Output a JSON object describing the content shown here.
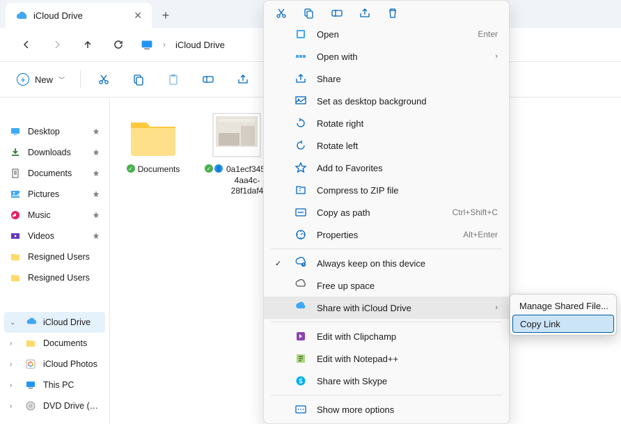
{
  "tab": {
    "title": "iCloud Drive"
  },
  "nav": {
    "breadcrumb": "iCloud Drive"
  },
  "toolbar": {
    "new_label": "New"
  },
  "sidebar": {
    "quick": [
      {
        "icon": "desktop",
        "label": "Desktop",
        "pinned": true
      },
      {
        "icon": "downloads",
        "label": "Downloads",
        "pinned": true
      },
      {
        "icon": "documents",
        "label": "Documents",
        "pinned": true
      },
      {
        "icon": "pictures",
        "label": "Pictures",
        "pinned": true
      },
      {
        "icon": "music",
        "label": "Music",
        "pinned": true
      },
      {
        "icon": "videos",
        "label": "Videos",
        "pinned": true
      },
      {
        "icon": "folder",
        "label": "Resigned Users",
        "pinned": false
      },
      {
        "icon": "folder",
        "label": "Resigned Users",
        "pinned": false
      }
    ],
    "tree": [
      {
        "icon": "icloud",
        "label": "iCloud Drive",
        "exp": "v",
        "selected": true
      },
      {
        "icon": "folder",
        "label": "Documents",
        "exp": ">",
        "selected": false
      },
      {
        "icon": "iclphotos",
        "label": "iCloud Photos",
        "exp": ">",
        "selected": false
      },
      {
        "icon": "thispc",
        "label": "This PC",
        "exp": ">",
        "selected": false
      },
      {
        "icon": "dvd",
        "label": "DVD Drive (F:)",
        "exp": ">",
        "selected": false
      }
    ]
  },
  "files": [
    {
      "kind": "folder",
      "name": "Documents",
      "badges": [
        "g"
      ]
    },
    {
      "kind": "photo",
      "name": "0a1ecf345-4aa4c-28f1daf4",
      "badges": [
        "g",
        "b"
      ]
    }
  ],
  "ctx": {
    "items": [
      {
        "icon": "open",
        "label": "Open",
        "hint": "Enter"
      },
      {
        "icon": "openwith",
        "label": "Open with",
        "arrow": true
      },
      {
        "icon": "share",
        "label": "Share"
      },
      {
        "icon": "bg",
        "label": "Set as desktop background"
      },
      {
        "icon": "rotr",
        "label": "Rotate right"
      },
      {
        "icon": "rotl",
        "label": "Rotate left"
      },
      {
        "icon": "fav",
        "label": "Add to Favorites"
      },
      {
        "icon": "zip",
        "label": "Compress to ZIP file"
      },
      {
        "icon": "path",
        "label": "Copy as path",
        "hint": "Ctrl+Shift+C"
      },
      {
        "icon": "prop",
        "label": "Properties",
        "hint": "Alt+Enter"
      }
    ],
    "cloud": [
      {
        "icon": "keep",
        "label": "Always keep on this device",
        "check": true
      },
      {
        "icon": "free",
        "label": "Free up space"
      },
      {
        "icon": "shareicl",
        "label": "Share with iCloud Drive",
        "arrow": true,
        "hov": true
      }
    ],
    "apps": [
      {
        "icon": "clip",
        "label": "Edit with Clipchamp"
      },
      {
        "icon": "npp",
        "label": "Edit with Notepad++"
      },
      {
        "icon": "skype",
        "label": "Share with Skype"
      }
    ],
    "more": {
      "icon": "more",
      "label": "Show more options"
    }
  },
  "submenu": [
    {
      "label": "Manage Shared File...",
      "sel": false
    },
    {
      "label": "Copy Link",
      "sel": true
    }
  ]
}
